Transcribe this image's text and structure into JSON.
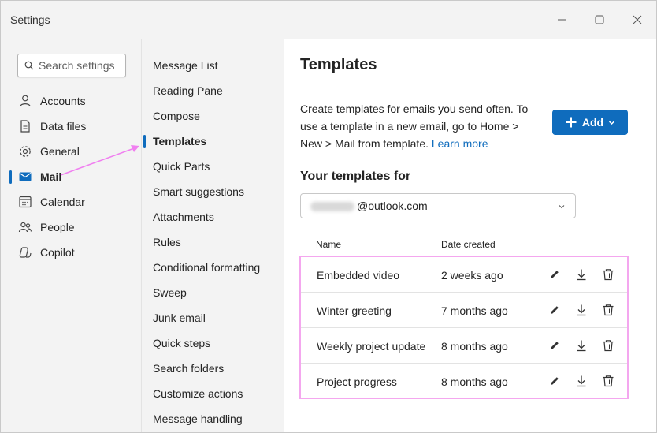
{
  "window": {
    "title": "Settings"
  },
  "search": {
    "placeholder": "Search settings"
  },
  "sidebar": {
    "items": [
      {
        "label": "Accounts",
        "icon": "person-icon"
      },
      {
        "label": "Data files",
        "icon": "document-icon"
      },
      {
        "label": "General",
        "icon": "gear-icon"
      },
      {
        "label": "Mail",
        "icon": "mail-icon",
        "active": true
      },
      {
        "label": "Calendar",
        "icon": "calendar-icon"
      },
      {
        "label": "People",
        "icon": "people-icon"
      },
      {
        "label": "Copilot",
        "icon": "copilot-icon"
      }
    ]
  },
  "mail_menu": {
    "items": [
      {
        "label": "Message List"
      },
      {
        "label": "Reading Pane"
      },
      {
        "label": "Compose"
      },
      {
        "label": "Templates",
        "active": true
      },
      {
        "label": "Quick Parts"
      },
      {
        "label": "Smart suggestions"
      },
      {
        "label": "Attachments"
      },
      {
        "label": "Rules"
      },
      {
        "label": "Conditional formatting"
      },
      {
        "label": "Sweep"
      },
      {
        "label": "Junk email"
      },
      {
        "label": "Quick steps"
      },
      {
        "label": "Search folders"
      },
      {
        "label": "Customize actions"
      },
      {
        "label": "Message handling"
      }
    ]
  },
  "content": {
    "title": "Templates",
    "description": "Create templates for emails you send often. To use a template in a new email, go to Home > New > Mail from template.",
    "learn_more": "Learn more",
    "add_label": "Add",
    "section_title": "Your templates for",
    "account_value": "@outlook.com",
    "columns": {
      "name": "Name",
      "date": "Date created"
    },
    "templates": [
      {
        "name": "Embedded video",
        "date": "2 weeks ago"
      },
      {
        "name": "Winter greeting",
        "date": "7 months ago"
      },
      {
        "name": "Weekly project update",
        "date": "8 months ago"
      },
      {
        "name": "Project progress",
        "date": "8 months ago"
      }
    ]
  },
  "colors": {
    "accent": "#0f6cbd",
    "highlight": "#f4a7ef",
    "annotation_arrow": "#f07ff0"
  }
}
